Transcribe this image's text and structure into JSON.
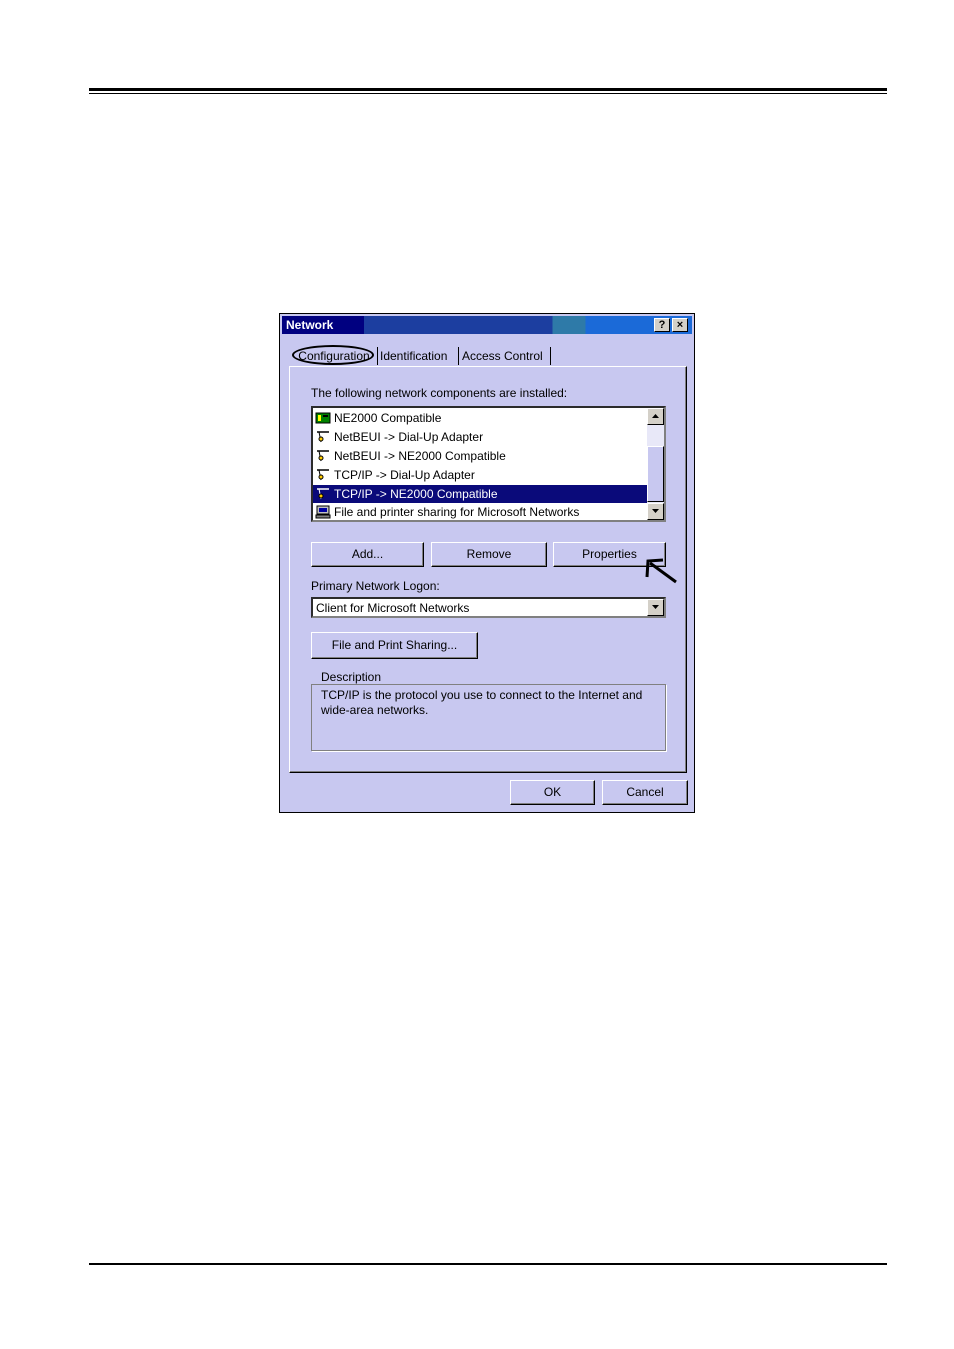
{
  "dialog": {
    "title": "Network",
    "help_button": "?",
    "close_button": "×",
    "tabs": [
      {
        "label": "Configuration"
      },
      {
        "label": "Identification"
      },
      {
        "label": "Access Control"
      }
    ],
    "components_label": "The following network components are installed:",
    "components": [
      {
        "label": "NE2000 Compatible",
        "icon": "network-card-icon"
      },
      {
        "label": "NetBEUI -> Dial-Up Adapter",
        "icon": "protocol-icon"
      },
      {
        "label": "NetBEUI -> NE2000 Compatible",
        "icon": "protocol-icon"
      },
      {
        "label": "TCP/IP -> Dial-Up Adapter",
        "icon": "protocol-icon"
      },
      {
        "label": "TCP/IP -> NE2000 Compatible",
        "icon": "protocol-icon",
        "selected": true
      },
      {
        "label": "File and printer sharing for Microsoft Networks",
        "icon": "service-icon"
      }
    ],
    "buttons": {
      "add": "Add...",
      "remove": "Remove",
      "properties": "Properties"
    },
    "logon_label": "Primary Network Logon:",
    "logon_value": "Client for Microsoft Networks",
    "file_print_sharing": "File and Print Sharing...",
    "description_legend": "Description",
    "description_text": "TCP/IP is the protocol you use to connect to the Internet and wide-area networks.",
    "ok": "OK",
    "cancel": "Cancel"
  }
}
